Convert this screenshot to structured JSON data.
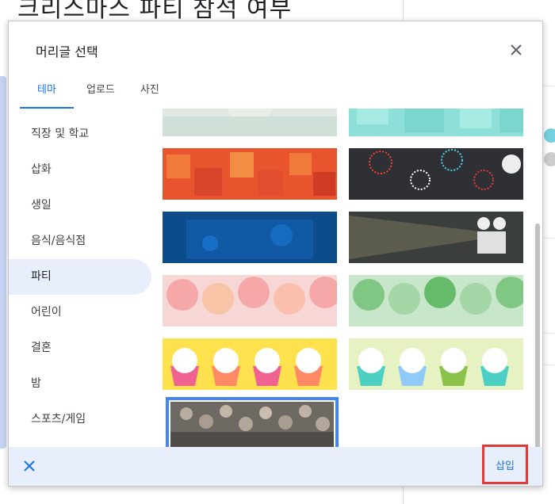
{
  "background": {
    "title": "크리스마스 파티 참석 여부"
  },
  "dialog": {
    "title": "머리글 선택",
    "close_icon": "close-icon",
    "tabs": [
      {
        "label": "테마",
        "active": true
      },
      {
        "label": "업로드",
        "active": false
      },
      {
        "label": "사진",
        "active": false
      }
    ],
    "categories": [
      {
        "label": "직장 및 학교",
        "active": false
      },
      {
        "label": "삽화",
        "active": false
      },
      {
        "label": "생일",
        "active": false
      },
      {
        "label": "음식/음식점",
        "active": false
      },
      {
        "label": "파티",
        "active": true
      },
      {
        "label": "어린이",
        "active": false
      },
      {
        "label": "결혼",
        "active": false
      },
      {
        "label": "밤",
        "active": false
      },
      {
        "label": "스포츠/게임",
        "active": false
      }
    ],
    "thumbnails": [
      {
        "name": "light-teal-pattern"
      },
      {
        "name": "aqua-gifts-pattern"
      },
      {
        "name": "red-gift-boxes"
      },
      {
        "name": "fireworks-dark"
      },
      {
        "name": "blue-dance-floor"
      },
      {
        "name": "film-projector"
      },
      {
        "name": "pink-balloons"
      },
      {
        "name": "green-balloons"
      },
      {
        "name": "cupcakes-yellow"
      },
      {
        "name": "cupcakes-green"
      },
      {
        "name": "bokeh-lights",
        "selected": true
      }
    ],
    "footer": {
      "cancel_icon": "close-icon",
      "insert_label": "삽입"
    }
  },
  "colors": {
    "accent": "#1a73e8",
    "selection": "#4285f4",
    "highlight_box": "#e53935",
    "footer_bg": "#e8eefb"
  }
}
